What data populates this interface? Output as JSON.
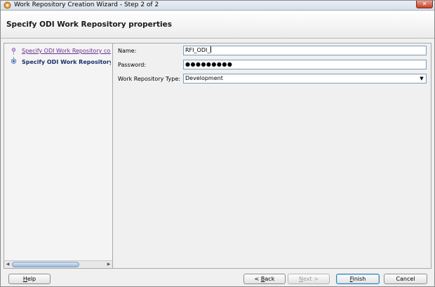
{
  "window": {
    "title": "Work Repository Creation Wizard - Step 2 of 2",
    "close_label": "✕"
  },
  "header": {
    "title": "Specify ODI Work Repository properties"
  },
  "steps": [
    {
      "label": "Specify ODI Work Repository conn",
      "state": "visited"
    },
    {
      "label": "Specify ODI Work Repository",
      "state": "current"
    }
  ],
  "nav_scrollbar": {
    "left_arrow": "◀",
    "right_arrow": "▶"
  },
  "form": {
    "name": {
      "label": "Name:",
      "value": "RFI_ODI_"
    },
    "password": {
      "label": "Password:",
      "value": "●●●●●●●●●"
    },
    "repo_type": {
      "label": "Work Repository Type:",
      "value": "Development",
      "arrow": "▼"
    }
  },
  "buttons": {
    "help": {
      "pre": "",
      "mn": "H",
      "post": "elp"
    },
    "back": {
      "pre": "< ",
      "mn": "B",
      "post": "ack"
    },
    "next": {
      "pre": "",
      "mn": "N",
      "post": "ext >"
    },
    "finish": {
      "pre": "",
      "mn": "F",
      "post": "inish"
    },
    "cancel": {
      "label": "Cancel"
    }
  },
  "colors": {
    "link_visited": "#6a2d8f",
    "step_current": "#1a2f6a",
    "input_border": "#7f9db9"
  }
}
